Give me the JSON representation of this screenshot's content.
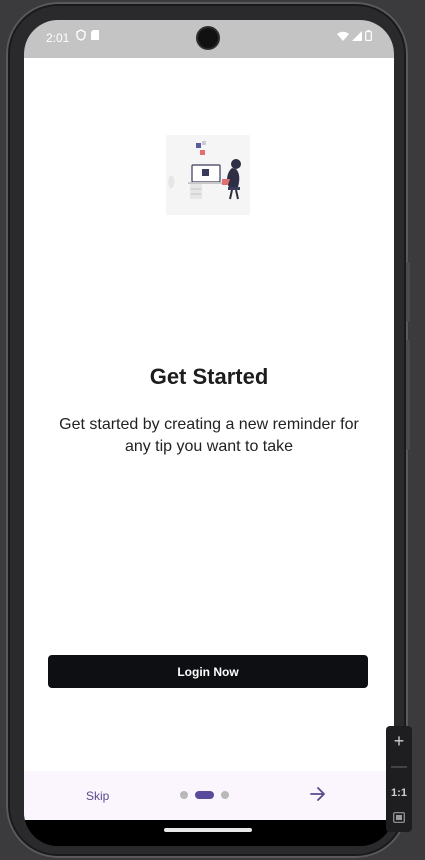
{
  "status_bar": {
    "time": "2:01",
    "left_icons": [
      "shield-icon",
      "sim-card-icon"
    ],
    "right_icons": [
      "wifi-icon",
      "signal-icon",
      "battery-icon"
    ]
  },
  "onboarding": {
    "illustration": "person-at-desk-illustration",
    "title": "Get Started",
    "subtitle": "Get started by creating a new reminder for any tip you want to take",
    "login_label": "Login Now"
  },
  "bottom_bar": {
    "skip_label": "Skip",
    "page_count": 3,
    "current_page": 2,
    "next_icon": "arrow-right-icon",
    "accent_color": "#5a4a9c"
  },
  "emulator_toolbar": {
    "zoom_in": "+",
    "zoom_out": "—",
    "ratio_label": "1:1"
  }
}
